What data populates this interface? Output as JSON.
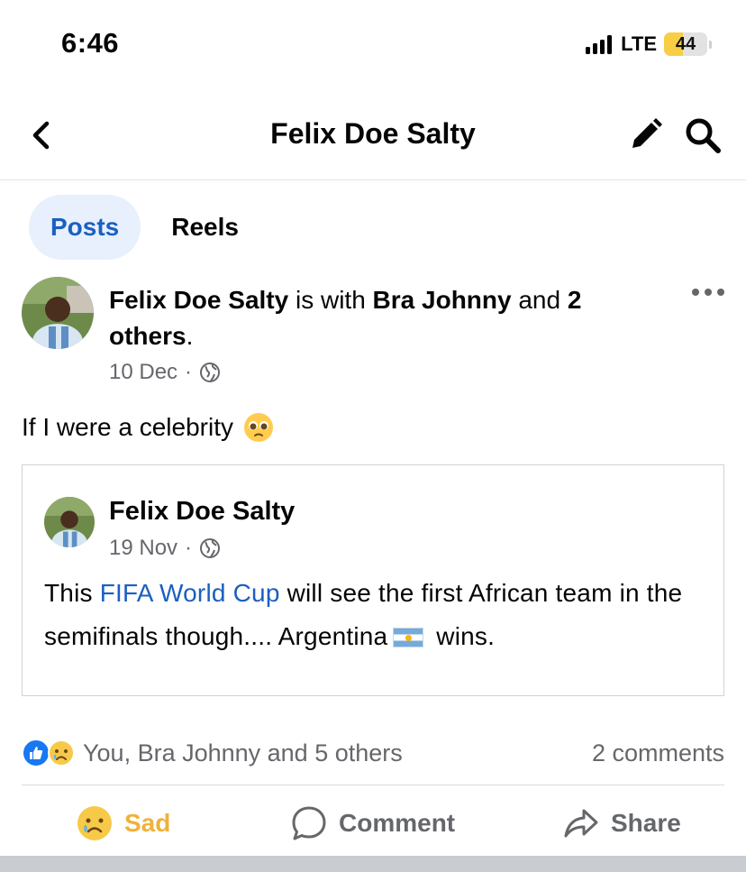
{
  "status_bar": {
    "time": "6:46",
    "network": "LTE",
    "battery": "44"
  },
  "header": {
    "title": "Felix Doe Salty"
  },
  "tabs": [
    {
      "label": "Posts",
      "active": true
    },
    {
      "label": "Reels",
      "active": false
    }
  ],
  "post": {
    "author": "Felix Doe Salty",
    "with_text": " is with ",
    "tagged": "Bra Johnny",
    "and_text": " and ",
    "others": "2 others",
    "period": ".",
    "date": "10 Dec",
    "dot": "·",
    "text": "If I were a celebrity",
    "shared": {
      "author": "Felix Doe Salty",
      "date": "19 Nov",
      "dot": "·",
      "body_before": "This ",
      "link": "FIFA World Cup",
      "body_after": " will see the first African team in the semifinals though.... Argentina",
      "body_end": " wins."
    },
    "reactions_text": "You, Bra Johnny and 5 others",
    "comments_text": "2 comments",
    "actions": {
      "react": "Sad",
      "comment": "Comment",
      "share": "Share"
    }
  },
  "colors": {
    "accent": "#1b5fc1",
    "tab_active_bg": "#e7f0fc",
    "secondary_text": "#65676b",
    "sad_reaction": "#f0b13a",
    "like_blue": "#1877f2"
  }
}
